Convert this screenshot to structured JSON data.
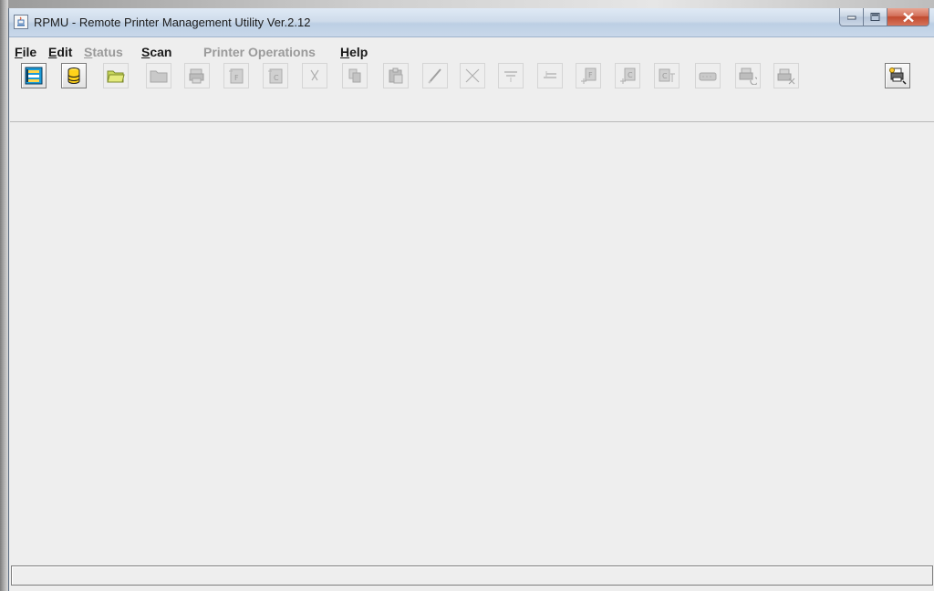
{
  "window": {
    "title": "RPMU - Remote Printer Management Utility Ver.2.12"
  },
  "menu": [
    {
      "label": "File",
      "mnemonic": "F",
      "rest": "ile",
      "enabled": true
    },
    {
      "label": "Edit",
      "mnemonic": "E",
      "rest": "dit",
      "enabled": true
    },
    {
      "label": "Status",
      "mnemonic": "S",
      "rest": "tatus",
      "enabled": false
    },
    {
      "label": "Scan",
      "mnemonic": "S",
      "rest": "can",
      "enabled": true
    },
    {
      "label": "Printer Operations",
      "mnemonic": "",
      "rest": "Printer Operations",
      "enabled": false
    },
    {
      "label": "Help",
      "mnemonic": "H",
      "rest": "elp",
      "enabled": true
    }
  ],
  "toolbar": [
    {
      "icon": "printer-list-icon",
      "enabled": true
    },
    {
      "icon": "database-icon",
      "enabled": true
    },
    {
      "icon": "open-folder-icon",
      "enabled": true
    },
    {
      "icon": "folder-icon",
      "enabled": false
    },
    {
      "icon": "printer-status-icon",
      "enabled": false
    },
    {
      "icon": "file-f-icon",
      "enabled": false
    },
    {
      "icon": "file-c-icon",
      "enabled": false
    },
    {
      "icon": "cut-icon",
      "enabled": false
    },
    {
      "icon": "copy-icon",
      "enabled": false
    },
    {
      "icon": "paste-icon",
      "enabled": false
    },
    {
      "icon": "edit-pencil-icon",
      "enabled": false
    },
    {
      "icon": "delete-x-icon",
      "enabled": false
    },
    {
      "icon": "insert-below-icon",
      "enabled": false
    },
    {
      "icon": "insert-above-icon",
      "enabled": false
    },
    {
      "icon": "add-file-f-icon",
      "enabled": false
    },
    {
      "icon": "add-file-c-icon",
      "enabled": false
    },
    {
      "icon": "file-c-compare-icon",
      "enabled": false
    },
    {
      "icon": "panel-icon",
      "enabled": false
    },
    {
      "icon": "printer-refresh-icon",
      "enabled": false
    },
    {
      "icon": "printer-delete-icon",
      "enabled": false
    },
    {
      "icon": "printer-search-icon",
      "enabled": true
    }
  ],
  "status_bar": {
    "text": ""
  },
  "colors": {
    "titlebar": "#cfdceb",
    "close_button": "#c14a2f",
    "menu_disabled": "#9a9a9a"
  }
}
